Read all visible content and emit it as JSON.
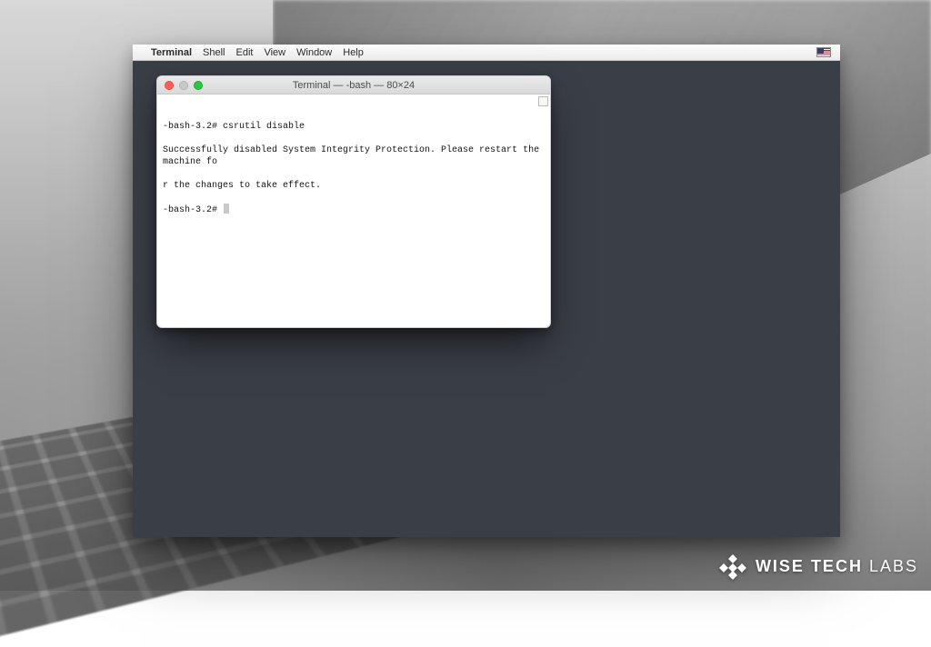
{
  "menubar": {
    "app_name": "Terminal",
    "items": [
      "Shell",
      "Edit",
      "View",
      "Window",
      "Help"
    ],
    "input_flag": "us-flag"
  },
  "terminal": {
    "title": "Terminal — -bash — 80×24",
    "lines": [
      "-bash-3.2# csrutil disable",
      "Successfully disabled System Integrity Protection. Please restart the machine fo",
      "r the changes to take effect.",
      "-bash-3.2# "
    ]
  },
  "watermark": {
    "brand_primary": "WISE TECH",
    "brand_secondary": "LABS"
  }
}
